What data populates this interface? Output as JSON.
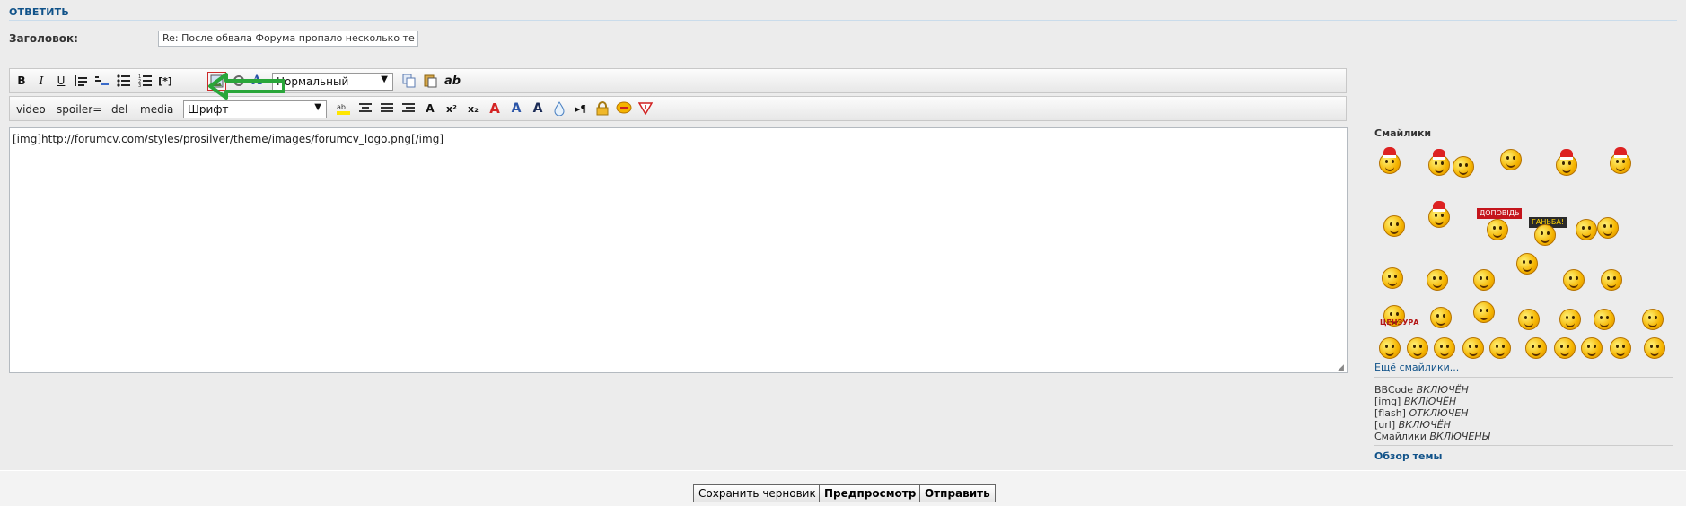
{
  "panel": {
    "title": "ОТВЕТИТЬ",
    "subject_label": "Заголовок:",
    "subject_value": "Re: После обвала Форума пропало несколько те"
  },
  "toolbar1": {
    "bold": "B",
    "italic": "I",
    "underline": "U",
    "quote": "",
    "code": "",
    "list": "",
    "list_ordered": "",
    "list_item": "[*]",
    "font_size_select": "Нормальный",
    "ab": "ab"
  },
  "toolbar2": {
    "video": "video",
    "spoiler": "spoiler=",
    "del": "del",
    "media": "media",
    "font_select": "Шрифт"
  },
  "editor": {
    "content": "[img]http://forumcv.com/styles/prosilver/theme/images/forumcv_logo.png[/img]"
  },
  "sidebar": {
    "smilies_title": "Смайлики",
    "more_smilies": "Ещё смайлики...",
    "sign_dopovid": "ДОПОВІДЬ",
    "sign_ganba": "ГАНЬБА!",
    "sign_cenzura": "ЦЕНЗУРА",
    "status": [
      {
        "key": "BBCode",
        "value": "ВКЛЮЧЁН"
      },
      {
        "key": "[img]",
        "value": "ВКЛЮЧЁН"
      },
      {
        "key": "[flash]",
        "value": "ОТКЛЮЧЕН"
      },
      {
        "key": "[url]",
        "value": "ВКЛЮЧЁН"
      },
      {
        "key": "Смайлики",
        "value": "ВКЛЮЧЕНЫ"
      }
    ],
    "topic_review": "Обзор темы"
  },
  "buttons": {
    "save_draft": "Сохранить черновик",
    "preview": "Предпросмотр",
    "submit": "Отправить"
  },
  "colors": {
    "accent": "#105289",
    "highlight_arrow": "#2aa63a",
    "image_button_border": "#cc2a2a"
  }
}
